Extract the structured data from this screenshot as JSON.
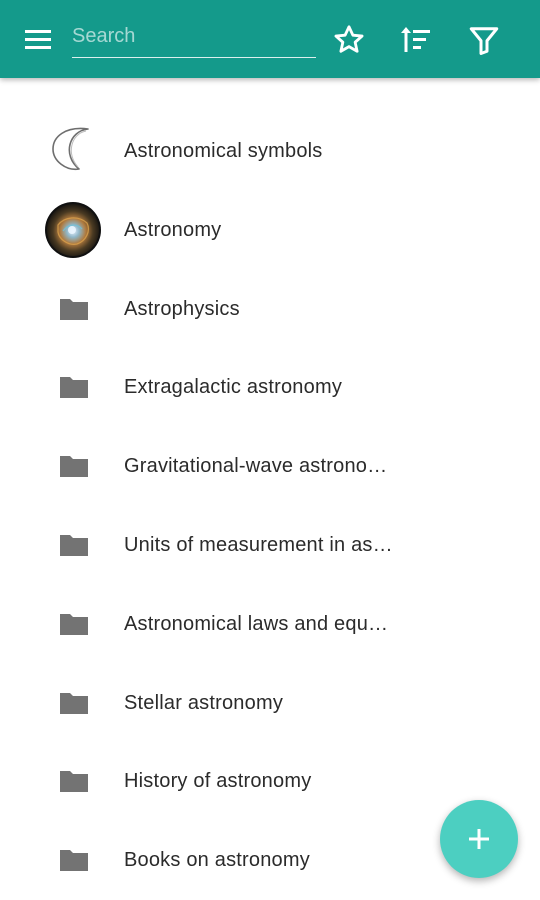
{
  "app_bar": {
    "search": {
      "placeholder": "Search",
      "value": ""
    },
    "background_color": "#149a8b"
  },
  "categories": [
    {
      "label": "Astronomical symbols",
      "icon": "crescent-moon-icon"
    },
    {
      "label": "Astronomy",
      "icon": "nebula-photo"
    },
    {
      "label": "Astrophysics",
      "icon": "folder-icon"
    },
    {
      "label": "Extragalactic astronomy",
      "icon": "folder-icon"
    },
    {
      "label": "Gravitational-wave astrono…",
      "icon": "folder-icon"
    },
    {
      "label": "Units of measurement in as…",
      "icon": "folder-icon"
    },
    {
      "label": "Astronomical laws and equ…",
      "icon": "folder-icon"
    },
    {
      "label": "Stellar astronomy",
      "icon": "folder-icon"
    },
    {
      "label": "History of astronomy",
      "icon": "folder-icon"
    },
    {
      "label": "Books on astronomy",
      "icon": "folder-icon"
    }
  ],
  "fab": {
    "icon": "plus-icon",
    "color": "#4ccfc1"
  }
}
